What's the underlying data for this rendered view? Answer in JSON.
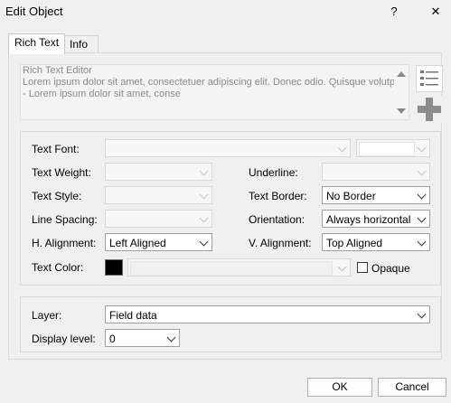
{
  "window": {
    "title": "Edit Object",
    "help_label": "?",
    "close_label": "✕"
  },
  "tabs": [
    {
      "label": "Rich Text"
    },
    {
      "label": "Info"
    }
  ],
  "editor": {
    "lines": [
      "Rich Text Editor",
      "Lorem ipsum dolor sit amet, consectetuer adipiscing elit. Donec odio. Quisque volutpat m",
      "- Lorem ipsum dolor sit amet, conse"
    ]
  },
  "side_icons": [
    "list-icon",
    "plus-icon"
  ],
  "format": {
    "text_font_label": "Text Font:",
    "text_weight_label": "Text Weight:",
    "underline_label": "Underline:",
    "text_style_label": "Text Style:",
    "text_border_label": "Text Border:",
    "text_border_value": "No Border",
    "line_spacing_label": "Line Spacing:",
    "orientation_label": "Orientation:",
    "orientation_value": "Always horizontal",
    "h_alignment_label": "H. Alignment:",
    "h_alignment_value": "Left Aligned",
    "v_alignment_label": "V. Alignment:",
    "v_alignment_value": "Top Aligned",
    "text_color_label": "Text Color:",
    "text_color": "#000000",
    "opaque_label": "Opaque",
    "opaque_checked": false
  },
  "layer": {
    "layer_label": "Layer:",
    "layer_value": "Field data",
    "display_level_label": "Display level:",
    "display_level_value": "0"
  },
  "buttons": {
    "ok": "OK",
    "cancel": "Cancel"
  }
}
